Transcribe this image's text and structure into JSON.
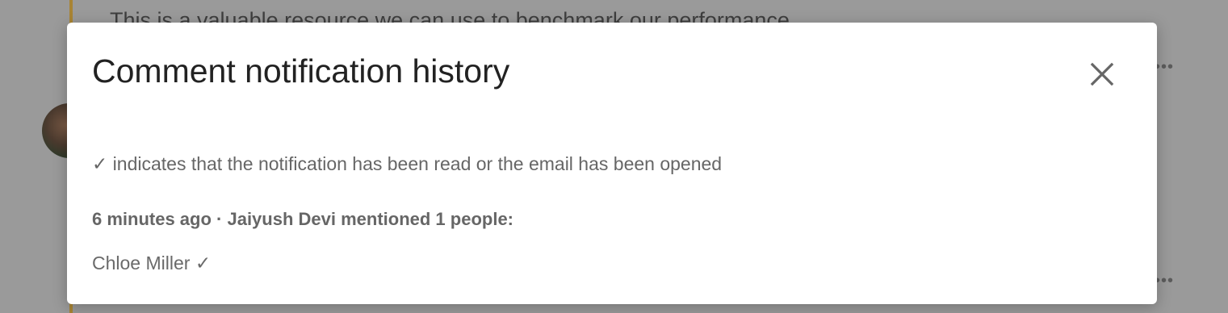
{
  "background": {
    "comment_text": "This is a valuable resource we can use to benchmark our performance",
    "more_options_icon": "more-horizontal-icon",
    "accent_color": "#a88434"
  },
  "modal": {
    "title": "Comment notification history",
    "close_icon": "close-icon",
    "legend": "✓ indicates that the notification has been read or the email has been opened",
    "entries": [
      {
        "summary": "6 minutes ago · Jaiyush Devi mentioned 1 people:",
        "recipients": [
          "Chloe Miller ✓"
        ]
      }
    ]
  }
}
